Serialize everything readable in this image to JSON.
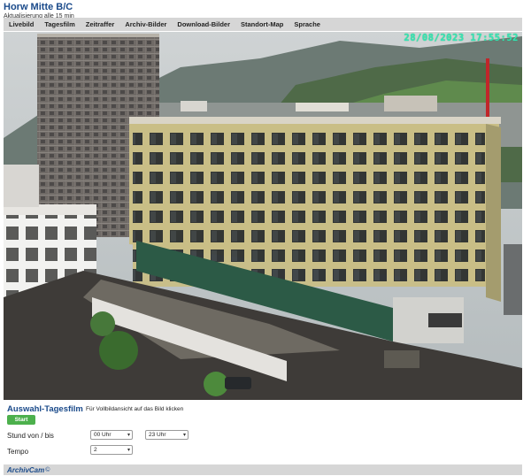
{
  "header": {
    "title": "Horw Mitte B/C",
    "subtitle": "Aktualisierung alle 15 min"
  },
  "nav": {
    "items": [
      "Livebild",
      "Tagesfilm",
      "Zeitraffer",
      "Archiv-Bilder",
      "Download-Bilder",
      "Standort-Map",
      "Sprache"
    ]
  },
  "camera": {
    "timestamp": "28/08/2023 17:55:52",
    "timestamp_color": "#37e0b8"
  },
  "tagesfilm": {
    "title": "Auswahl-Tagesfilm",
    "hint": "Für Vollbildansicht auf das Bild klicken",
    "start_label": "Start",
    "hours_label": "Stund von / bis",
    "from_value": "00 Uhr",
    "to_value": "23 Uhr",
    "tempo_label": "Tempo",
    "tempo_value": "2"
  },
  "footer": {
    "logo": "ArchivCam",
    "copyright": "©"
  },
  "colors": {
    "brand_blue": "#1a4a8a",
    "start_green": "#4cb04c",
    "bar_gray": "#d6d6d6"
  }
}
